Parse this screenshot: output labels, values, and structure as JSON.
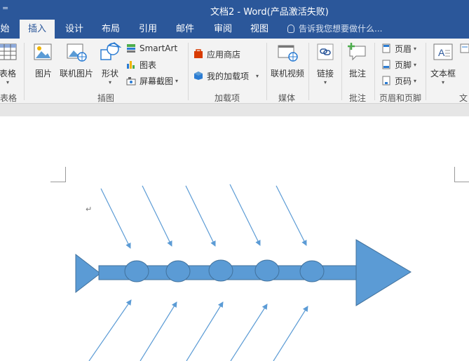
{
  "title_bar": {
    "quick_access": "=",
    "title": "文档2 - Word(产品激活失败)"
  },
  "tabs": [
    {
      "label": "始",
      "active": false
    },
    {
      "label": "插入",
      "active": true
    },
    {
      "label": "设计",
      "active": false
    },
    {
      "label": "布局",
      "active": false
    },
    {
      "label": "引用",
      "active": false
    },
    {
      "label": "邮件",
      "active": false
    },
    {
      "label": "审阅",
      "active": false
    },
    {
      "label": "视图",
      "active": false
    }
  ],
  "tell_me": {
    "placeholder": "告诉我您想要做什么..."
  },
  "ribbon": {
    "table_group": {
      "button": "表格",
      "label": "表格"
    },
    "illustrations": {
      "label": "插图",
      "picture": "图片",
      "online_picture": "联机图片",
      "shapes": "形状",
      "smartart": "SmartArt",
      "chart": "图表",
      "screenshot": "屏幕截图"
    },
    "addins": {
      "label": "加载项",
      "store": "应用商店",
      "my_addins": "我的加载项"
    },
    "media": {
      "label": "媒体",
      "online_video": "联机视频"
    },
    "links": {
      "label": "",
      "link": "链接"
    },
    "comments": {
      "label": "批注",
      "comment": "批注"
    },
    "header_footer": {
      "label": "页眉和页脚",
      "header": "页眉",
      "footer": "页脚",
      "page_number": "页码"
    },
    "text": {
      "label": "文",
      "textbox": "文本框"
    }
  },
  "document": {
    "paragraph_mark": "↵"
  },
  "colors": {
    "accent": "#2b579a",
    "shape_fill": "#5b9bd5",
    "shape_stroke": "#41719c"
  }
}
